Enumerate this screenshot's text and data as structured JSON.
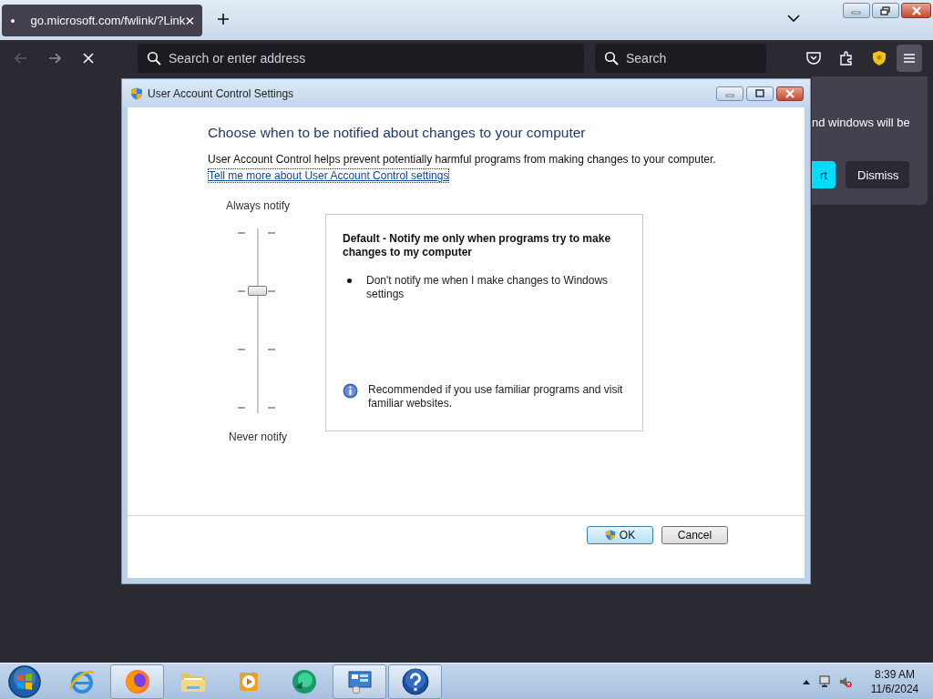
{
  "browser": {
    "tab": {
      "title": "go.microsoft.com/fwlink/?Link",
      "loading": true
    },
    "address_bar": {
      "placeholder": "Search or enter address"
    },
    "search_bar": {
      "placeholder": "Search"
    },
    "notification": {
      "text": "nd windows will be",
      "buttons": [
        {
          "label": "rt",
          "kind": "primary"
        },
        {
          "label": "Dismiss",
          "kind": "secondary"
        }
      ]
    }
  },
  "dialog": {
    "title": "User Account Control Settings",
    "heading": "Choose when to be notified about changes to your computer",
    "description": "User Account Control helps prevent potentially harmful programs from making changes to your computer.",
    "link": "Tell me more about User Account Control settings",
    "slider": {
      "top_label": "Always notify",
      "bottom_label": "Never notify",
      "level": 0.67
    },
    "info": {
      "title": "Default - Notify me only when programs try to make changes to my computer",
      "bullets": [
        "Don't notify me when I make changes to Windows settings"
      ],
      "note": "Recommended if you use familiar programs and visit familiar websites."
    },
    "buttons": [
      {
        "label": "OK",
        "kind": "default",
        "shield": true
      },
      {
        "label": "Cancel",
        "kind": "normal",
        "shield": false
      }
    ]
  },
  "taskbar": {
    "items": [
      {
        "kind": "ie",
        "running": false
      },
      {
        "kind": "firefox",
        "running": true
      },
      {
        "kind": "folder",
        "running": false
      },
      {
        "kind": "media",
        "running": false
      },
      {
        "kind": "green",
        "running": false
      },
      {
        "kind": "control",
        "running": true
      },
      {
        "kind": "help",
        "running": true
      }
    ],
    "clock": {
      "time": "8:39 AM",
      "date": "11/6/2024"
    }
  }
}
